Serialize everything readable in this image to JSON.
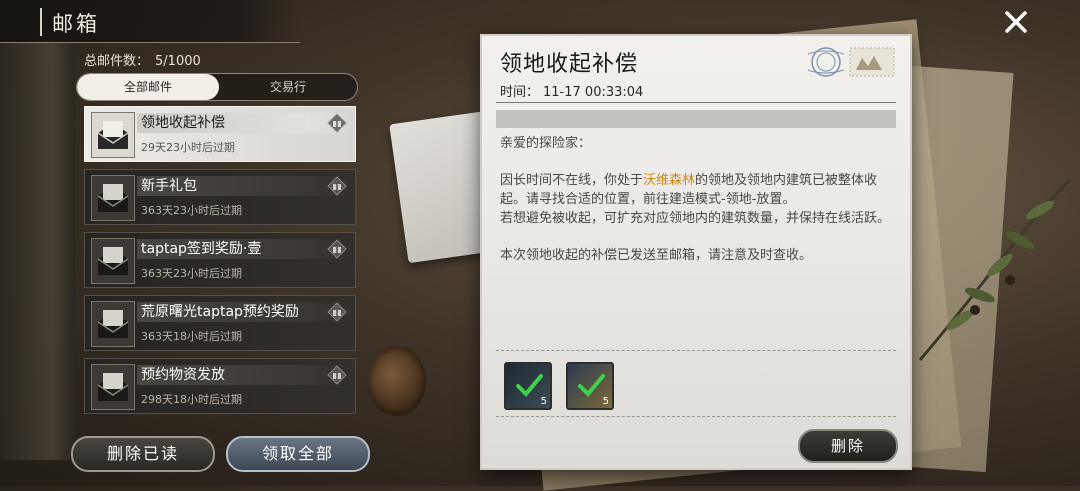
{
  "header": {
    "title": "邮箱"
  },
  "mailbox": {
    "total_label": "总邮件数：",
    "total_value": "5/1000"
  },
  "tabs": [
    {
      "label": "全部邮件"
    },
    {
      "label": "交易行"
    }
  ],
  "mails": [
    {
      "name": "领地收起补偿",
      "expire": "29天23小时后过期",
      "selected": true
    },
    {
      "name": "新手礼包",
      "expire": "363天23小时后过期",
      "selected": false
    },
    {
      "name": "taptap签到奖励·壹",
      "expire": "363天23小时后过期",
      "selected": false
    },
    {
      "name": "荒原曙光taptap预约奖励",
      "expire": "363天18小时后过期",
      "selected": false
    },
    {
      "name": "预约物资发放",
      "expire": "298天18小时后过期",
      "selected": false
    }
  ],
  "buttons": {
    "delete_read": "删除已读",
    "claim_all": "领取全部"
  },
  "detail": {
    "title": "领地收起补偿",
    "time_label": "时间：",
    "time_value": "11-17 00:33:04",
    "greeting": "亲爱的探险家：",
    "p1_a": "因长时间不在线，你处于",
    "p1_highlight": "沃维森林",
    "p1_b": "的领地及领地内建筑已被整体收起。请寻找合适的位置，前往建造模式-领地-放置。",
    "p2": "若想避免被收起，可扩充对应领地内的建筑数量，并保持在线活跃。",
    "p3": "本次领地收起的补偿已发送至邮箱，请注意及时查收。",
    "rewards": [
      {
        "qty": "5"
      },
      {
        "qty": "5"
      }
    ],
    "delete_label": "删除"
  },
  "colors": {
    "highlight": "#c98a1c",
    "selected_bg": "#ecebe6",
    "panel_bg": "#f2f1ee"
  }
}
